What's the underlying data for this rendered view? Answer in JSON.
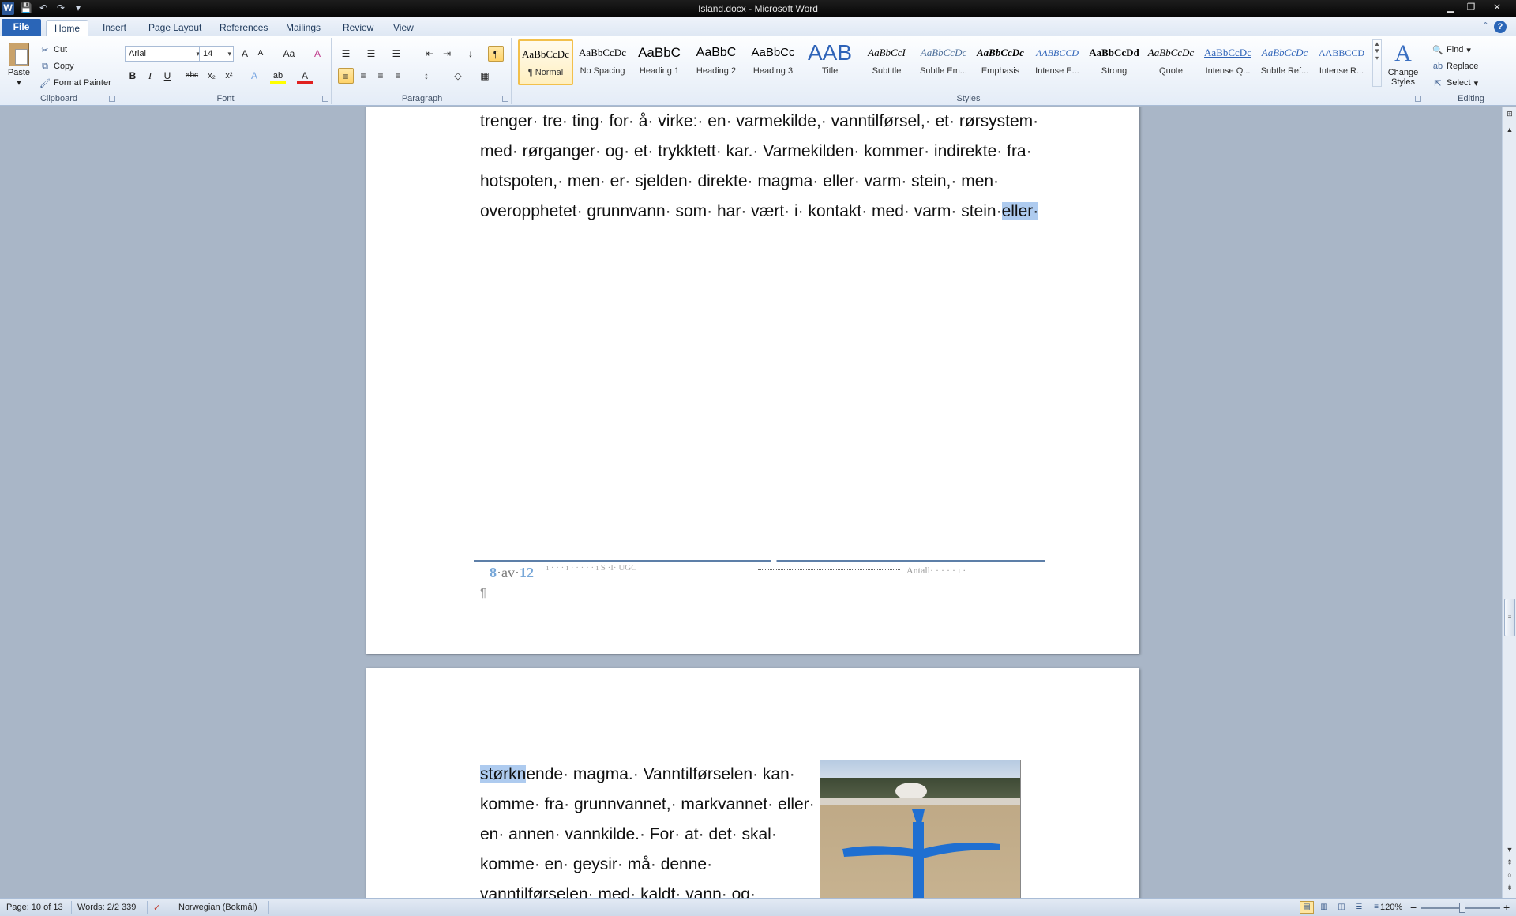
{
  "window": {
    "title": "Island.docx - Microsoft Word",
    "app_icon": "W",
    "minimize": "▁",
    "restore": "❐",
    "close": "✕"
  },
  "qat": {
    "save": "💾",
    "undo": "↶",
    "redo": "↷",
    "customize": "▾"
  },
  "tabs": [
    {
      "label": "File"
    },
    {
      "label": "Home"
    },
    {
      "label": "Insert"
    },
    {
      "label": "Page Layout"
    },
    {
      "label": "References"
    },
    {
      "label": "Mailings"
    },
    {
      "label": "Review"
    },
    {
      "label": "View"
    }
  ],
  "help": "?",
  "ribbon": {
    "clipboard": {
      "label": "Clipboard",
      "paste": "Paste",
      "cut": "Cut",
      "copy": "Copy",
      "format_painter": "Format Painter"
    },
    "font": {
      "label": "Font",
      "font_name": "Arial",
      "font_size": "14",
      "grow": "A",
      "shrink": "A",
      "change_case": "Aa",
      "clear": "A",
      "bold": "B",
      "italic": "I",
      "underline": "U",
      "strike": "abc",
      "subscript": "x₂",
      "superscript": "x²",
      "text_effects": "A",
      "highlight": "ab",
      "font_color": "A",
      "font_color_hex": "#e02020",
      "highlight_hex": "#ffff00"
    },
    "paragraph": {
      "label": "Paragraph",
      "bullets": "☰",
      "numbering": "☰",
      "multilevel": "☰",
      "decrease_indent": "⇤",
      "increase_indent": "⇥",
      "sort": "↓",
      "show_marks": "¶",
      "align_left": "≡",
      "center": "≡",
      "align_right": "≡",
      "justify": "≡",
      "line_spacing": "↕",
      "shading": "◇",
      "borders": "▦"
    },
    "styles": {
      "label": "Styles",
      "items": [
        {
          "sample": "AaBbCcDc",
          "name": "¶ Normal"
        },
        {
          "sample": "AaBbCcDc",
          "name": "No Spacing"
        },
        {
          "sample": "AaBbC",
          "name": "Heading 1"
        },
        {
          "sample": "AaBbC",
          "name": "Heading 2"
        },
        {
          "sample": "AaBbCc",
          "name": "Heading 3"
        },
        {
          "sample": "AAB",
          "name": "Title"
        },
        {
          "sample": "AaBbCcI",
          "name": "Subtitle"
        },
        {
          "sample": "AaBbCcDc",
          "name": "Subtle Em..."
        },
        {
          "sample": "AaBbCcDc",
          "name": "Emphasis"
        },
        {
          "sample": "AABBCCD",
          "name": "Intense E..."
        },
        {
          "sample": "AaBbCcDd",
          "name": "Strong"
        },
        {
          "sample": "AaBbCcDc",
          "name": "Quote"
        },
        {
          "sample": "AaBbCcDc",
          "name": "Intense Q..."
        },
        {
          "sample": "AaBbCcDc",
          "name": "Subtle Ref..."
        },
        {
          "sample": "AABBCCD",
          "name": "Intense R..."
        }
      ],
      "change_styles_icon": "A",
      "change_styles": "Change Styles"
    },
    "editing": {
      "label": "Editing",
      "find": "Find",
      "replace": "Replace",
      "select": "Select"
    }
  },
  "document": {
    "page1_lines": [
      "trenger· tre· ting· for· å· virke:· en· varmekilde,· vanntilførsel,· et· rørsystem·",
      "med· rørganger· og· et· trykktett· kar.· Varmekilden· kommer· indirekte· fra·",
      "hotspoten,· men· er· sjelden· direkte· magma· eller· varm· stein,· men·",
      "overopphetet· grunnvann· som· har· vært· i· kontakt· med· varm· stein·"
    ],
    "page1_highlight": "eller·",
    "footer": {
      "page_num": "8",
      "of": "·av·",
      "total": "12",
      "faint_text": "ı · ·  ·  ı  ·  ·  ·   ·   ·  ı  S ·Ι· UGC",
      "right_text": "Antall·  ·  ·  ·  ·  ı  ·"
    },
    "pilcrow": "¶",
    "page2_first_highlight": "størkn",
    "page2_lines": [
      "ende· magma.· Vanntilførselen· kan·",
      "komme· fra· grunnvannet,· markvannet· eller·",
      "en· annen· vannkilde.· For· at· det· skal·",
      "komme· en· geysir· må· denne·",
      "vanntilførselen· med· kaldt· vann· og·"
    ]
  },
  "status": {
    "page": "Page: 10 of 13",
    "words": "Words: 2/2 339",
    "language": "Norwegian (Bokmål)",
    "zoom": "120%",
    "zoom_out": "−",
    "zoom_in": "+"
  }
}
